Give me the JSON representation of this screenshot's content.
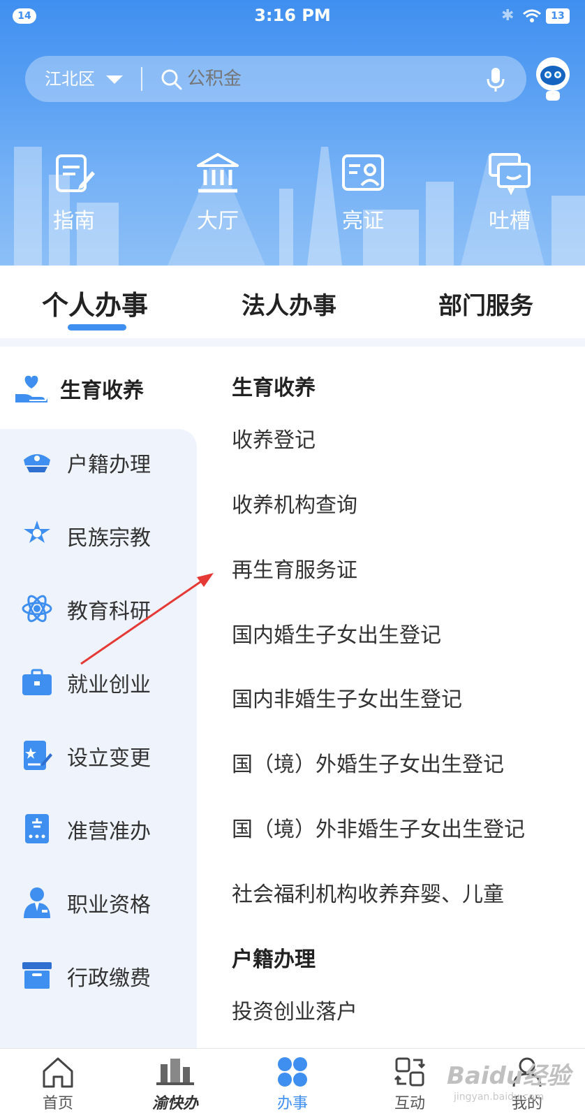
{
  "status_bar": {
    "notif_count": "14",
    "time": "3:16 PM",
    "battery": "13"
  },
  "search": {
    "district": "江北区",
    "placeholder": "公积金"
  },
  "quick_actions": [
    {
      "label": "指南",
      "icon": "guide-icon"
    },
    {
      "label": "大厅",
      "icon": "hall-icon"
    },
    {
      "label": "亮证",
      "icon": "id-card-icon"
    },
    {
      "label": "吐槽",
      "icon": "feedback-icon"
    }
  ],
  "tabs": [
    "个人办事",
    "法人办事",
    "部门服务"
  ],
  "active_tab": "个人办事",
  "category": {
    "current": "生育收养"
  },
  "sidebar": [
    {
      "label": "户籍办理",
      "icon": "police-cap-icon"
    },
    {
      "label": "民族宗教",
      "icon": "star-icon"
    },
    {
      "label": "教育科研",
      "icon": "atom-icon"
    },
    {
      "label": "就业创业",
      "icon": "briefcase-icon"
    },
    {
      "label": "设立变更",
      "icon": "certificate-icon"
    },
    {
      "label": "准营准办",
      "icon": "permit-icon"
    },
    {
      "label": "职业资格",
      "icon": "professional-icon"
    },
    {
      "label": "行政缴费",
      "icon": "box-icon"
    }
  ],
  "services": {
    "section1_title": "生育收养",
    "section1_items": [
      "收养登记",
      "收养机构查询",
      "再生育服务证",
      "国内婚生子女出生登记",
      "国内非婚生子女出生登记",
      "国（境）外婚生子女出生登记",
      "国（境）外非婚生子女出生登记",
      "社会福利机构收养弃婴、儿童"
    ],
    "section2_title": "户籍办理",
    "section2_items": [
      "投资创业落户"
    ]
  },
  "bottom_nav": [
    {
      "label": "首页",
      "icon": "home-icon"
    },
    {
      "label": "渝快办",
      "icon": "logo-icon"
    },
    {
      "label": "办事",
      "icon": "services-icon"
    },
    {
      "label": "互动",
      "icon": "interact-icon"
    },
    {
      "label": "我的",
      "icon": "profile-icon"
    }
  ],
  "watermark": {
    "brand": "Baidu经验",
    "url": "jingyan.baidu.com"
  },
  "colors": {
    "accent": "#3f8ff0",
    "header": "#5aa0f3",
    "annotation": "#e53935"
  }
}
